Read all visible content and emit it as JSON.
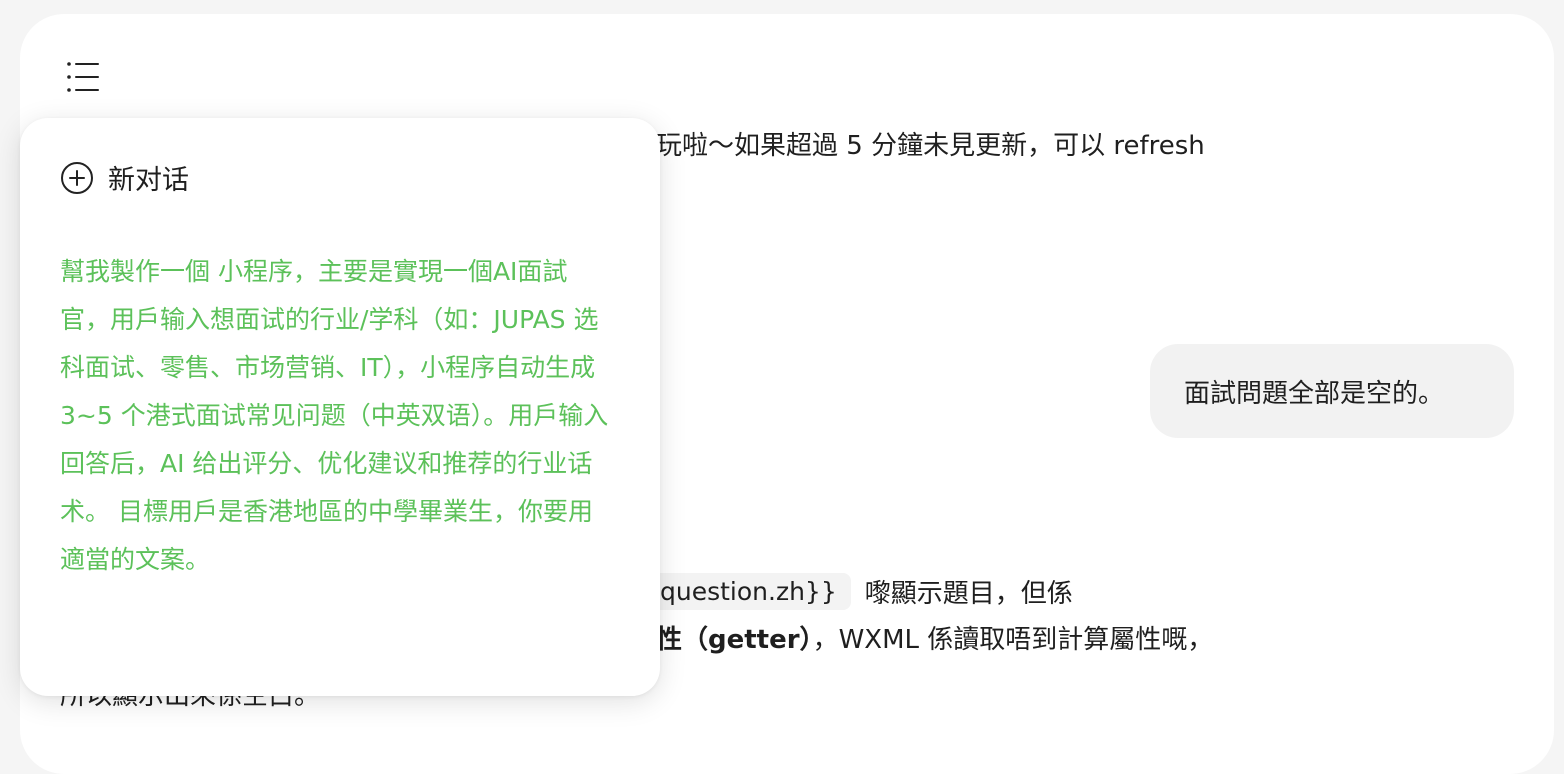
{
  "header": {
    "menu_icon": "list-menu-icon"
  },
  "chat": {
    "line_1": "玩啦～如果超過 5 分鐘未見更新，可以 refresh",
    "user_message": "面試問題全部是空的。",
    "code_snippet": "question.zh}}",
    "code_row_suffix": "嚟顯示題目，但係",
    "getter_bold": "性（getter）",
    "getter_rest": "，WXML 係讀取唔到計算屬性嘅，",
    "line_bottom": "所以顯示出來係空白。"
  },
  "history_popup": {
    "new_chat_icon": "plus-circle-icon",
    "new_chat_label": "新对话",
    "items": [
      {
        "title": "幫我製作一個 小程序，主要是實現一個AI面試官，用戶输入想面试的行业/学科（如：JUPAS 选科面试、零售、市场营销、IT），小程序自动生成 3~5 个港式面试常见问题（中英双语）。用戶输入回答后，AI 给出评分、优化建议和推荐的行业话术。 目標用戶是香港地區的中學畢業生，你要用適當的文案。"
      }
    ]
  },
  "colors": {
    "accent_green": "#5cc15a",
    "text": "#1f1f1f",
    "bubble": "#f2f2f2",
    "page_bg": "#f5f5f5"
  }
}
